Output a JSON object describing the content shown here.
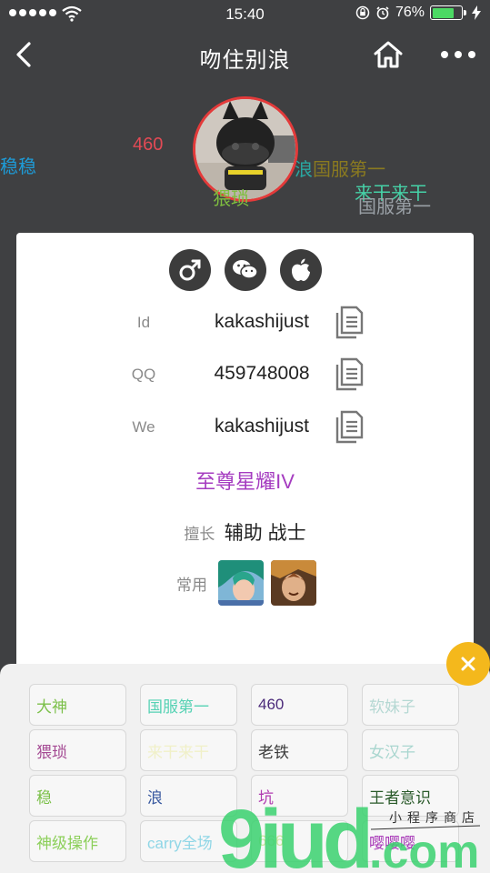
{
  "status_bar": {
    "time": "15:40",
    "battery": "76%",
    "battery_level": 0.76,
    "icons": [
      "signal-dots-icon",
      "wifi-icon",
      "lock-rotation-icon",
      "alarm-icon",
      "battery-icon",
      "charging-icon"
    ]
  },
  "nav": {
    "title": "吻住别浪",
    "back_icon": "back-chevron-icon",
    "home_icon": "home-icon",
    "more_icon": "more-dots-icon"
  },
  "floating_tags": [
    {
      "text": "稳稳",
      "color": "#1e9bd7"
    },
    {
      "text": "460",
      "color": "#e24a55"
    },
    {
      "text": "浪",
      "color": "#2aa6a0"
    },
    {
      "text": "国服第一",
      "color": "#8a7a20"
    },
    {
      "text": "猥琐",
      "color": "#7fbf3f"
    },
    {
      "text": "来干来干",
      "color": "#46d1a7"
    },
    {
      "text": "国服第一",
      "color": "#9aa0a6"
    }
  ],
  "profile": {
    "badge_icons": [
      "male-icon",
      "wechat-icon",
      "apple-icon"
    ],
    "fields": [
      {
        "label": "Id",
        "value": "kakashijust"
      },
      {
        "label": "QQ",
        "value": "459748008"
      },
      {
        "label": "We",
        "value": "kakashijust"
      }
    ],
    "rank": "至尊星耀IV",
    "specialty_label": "擅长",
    "specialty_value": "辅助 战士",
    "common_label": "常用",
    "common_heroes": [
      "hero-avatar-1",
      "hero-avatar-2"
    ]
  },
  "tags": [
    {
      "text": "大神",
      "color": "#7cc04a"
    },
    {
      "text": "国服第一",
      "color": "#56d2b4"
    },
    {
      "text": "460",
      "color": "#4b2a7a"
    },
    {
      "text": "软妹子",
      "color": "#b5d8d3"
    },
    {
      "text": "猥琐",
      "color": "#a44a93"
    },
    {
      "text": "来干来干",
      "color": "#f0f0c8"
    },
    {
      "text": "老铁",
      "color": "#3a3a3a"
    },
    {
      "text": "女汉子",
      "color": "#a9d6cf"
    },
    {
      "text": "稳",
      "color": "#7cc04a"
    },
    {
      "text": "浪",
      "color": "#3a5aa0"
    },
    {
      "text": "坑",
      "color": "#b03ab0"
    },
    {
      "text": "王者意识",
      "color": "#2a5a2a"
    },
    {
      "text": "神级操作",
      "color": "#8ccf5a"
    },
    {
      "text": "carry全场",
      "color": "#8fd6e6"
    },
    {
      "text": "666",
      "color": "#cde6a0"
    },
    {
      "text": "嘤嘤嘤",
      "color": "#a83ab8"
    }
  ],
  "close_icon": "close-icon",
  "watermark": {
    "text": "9iud.com",
    "subtitle": "小程序商店"
  }
}
